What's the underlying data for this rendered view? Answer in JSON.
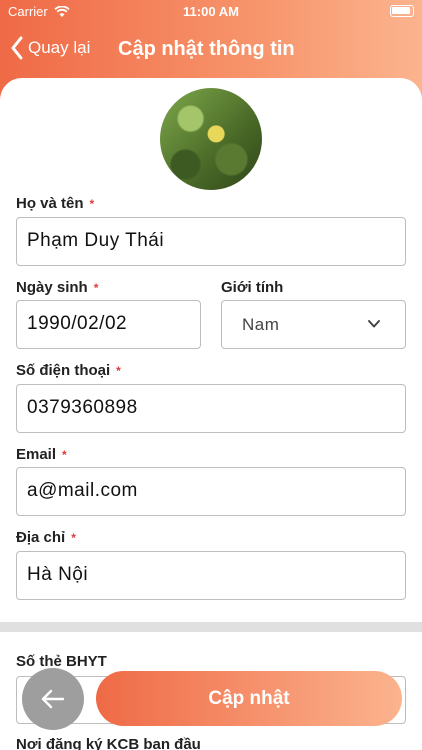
{
  "status": {
    "carrier": "Carrier",
    "time": "11:00 AM"
  },
  "nav": {
    "back_label": "Quay lại",
    "title": "Cập nhật thông tin"
  },
  "form": {
    "fullname": {
      "label": "Họ và tên",
      "value": "Phạm Duy Thái",
      "required": "*"
    },
    "dob": {
      "label": "Ngày sinh",
      "value": "1990/02/02",
      "required": "*"
    },
    "gender": {
      "label": "Giới tính",
      "value": "Nam"
    },
    "phone": {
      "label": "Số điện thoại",
      "value": "0379360898",
      "required": "*"
    },
    "email": {
      "label": "Email",
      "value": "a@mail.com",
      "required": "*"
    },
    "address": {
      "label": "Địa chỉ",
      "value": "Hà Nội",
      "required": "*"
    },
    "bhyt": {
      "label": "Số thẻ BHYT"
    },
    "kcb": {
      "label": "Nơi đăng ký KCB ban đầu"
    }
  },
  "actions": {
    "update_label": "Cập nhật"
  },
  "colors": {
    "accent_start": "#ef6a46",
    "accent_end": "#fbb48e",
    "required": "#e03a3a"
  }
}
